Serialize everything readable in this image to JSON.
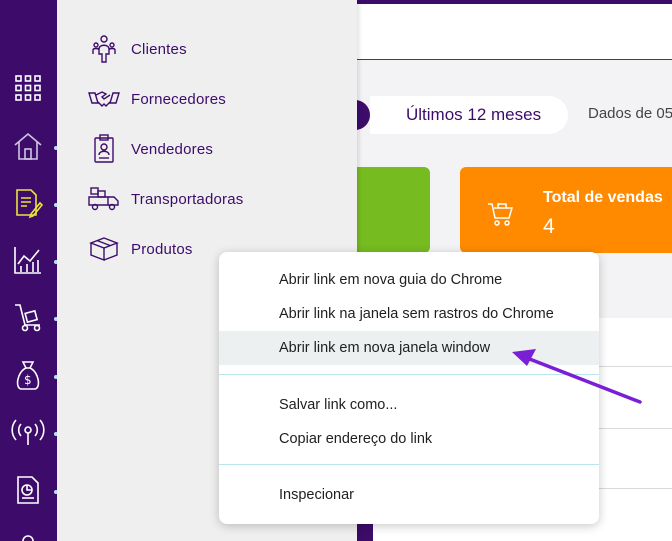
{
  "flyout": {
    "items": [
      {
        "label": "Clientes",
        "icon": "clients-icon"
      },
      {
        "label": "Fornecedores",
        "icon": "handshake-icon"
      },
      {
        "label": "Vendedores",
        "icon": "id-badge-icon"
      },
      {
        "label": "Transportadoras",
        "icon": "truck-icon"
      },
      {
        "label": "Produtos",
        "icon": "box-icon"
      }
    ]
  },
  "filter": {
    "period_label": "Últimos 12 meses",
    "data_label": "Dados de 05"
  },
  "cards": {
    "sales": {
      "title": "Total de vendas",
      "value": "4",
      "icon": "shopping-cart-icon"
    }
  },
  "context_menu": {
    "items": [
      "Abrir link em nova guia do Chrome",
      "Abrir link na janela sem rastros do Chrome",
      "Abrir link em nova janela window",
      "Salvar link como...",
      "Copiar endereço do link",
      "Inspecionar"
    ]
  },
  "colors": {
    "primary": "#3d0c6b",
    "green_card": "#76bc21",
    "orange_card": "#ff8a00",
    "annotation_arrow": "#7a1fd6"
  },
  "rail_icons": [
    "apps-grid-icon",
    "home-icon",
    "document-edit-icon",
    "chart-icon",
    "hand-truck-icon",
    "money-bag-icon",
    "broadcast-icon",
    "report-icon"
  ]
}
